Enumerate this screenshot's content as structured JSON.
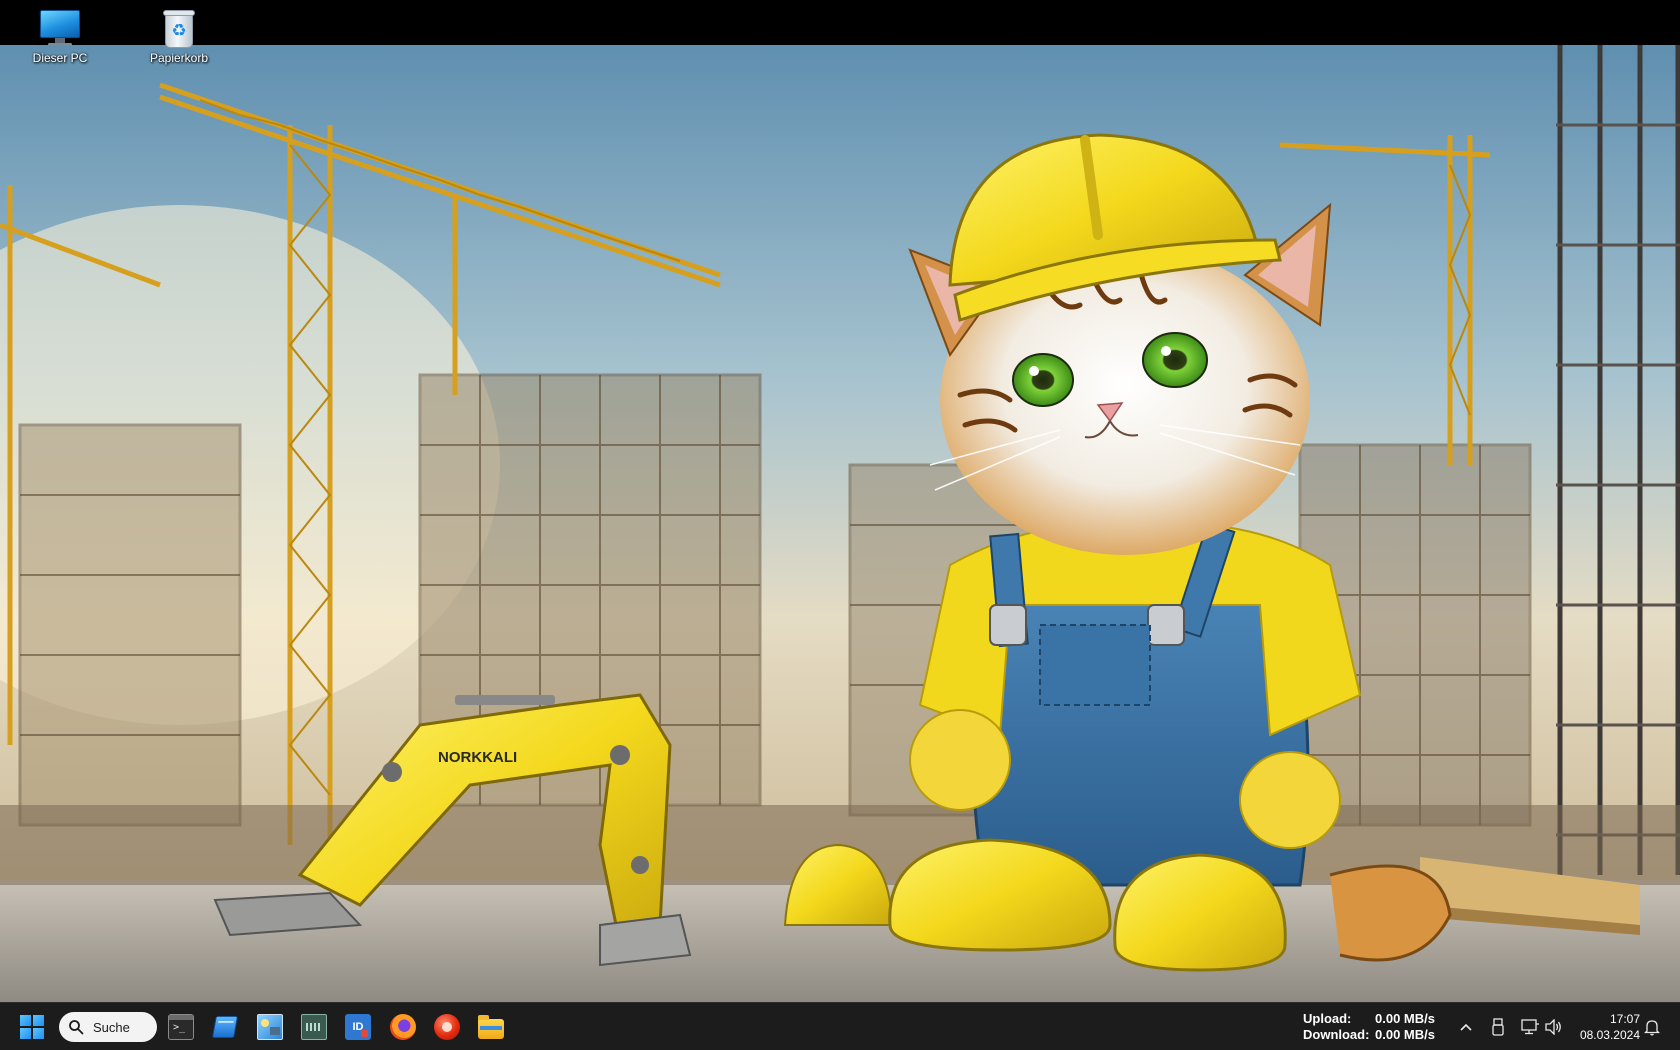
{
  "desktop": {
    "icons": [
      {
        "label": "Dieser PC",
        "icon": "computer-icon"
      },
      {
        "label": "Papierkorb",
        "icon": "recycle-bin-icon"
      }
    ],
    "wallpaper_text": "NORKKALI"
  },
  "taskbar": {
    "start": {
      "icon": "windows-start-icon"
    },
    "search": {
      "label": "Suche"
    },
    "apps": [
      {
        "id": "terminal",
        "icon": "terminal-icon",
        "glyph": ">_"
      },
      {
        "id": "window-app",
        "icon": "window-icon"
      },
      {
        "id": "display-settings",
        "icon": "display-icon"
      },
      {
        "id": "hardware-monitor",
        "icon": "chip-icon"
      },
      {
        "id": "id-app",
        "icon": "id-icon",
        "glyph": "ID"
      },
      {
        "id": "firefox",
        "icon": "firefox-icon"
      },
      {
        "id": "recorder",
        "icon": "record-icon"
      },
      {
        "id": "file-explorer",
        "icon": "folder-icon"
      }
    ],
    "network": {
      "upload_label": "Upload:",
      "upload_value": "0.00 MB/s",
      "download_label": "Download:",
      "download_value": "0.00 MB/s"
    },
    "tray": [
      {
        "icon": "chevron-up-icon"
      },
      {
        "icon": "usb-icon"
      },
      {
        "icon": "network-icon"
      },
      {
        "icon": "speaker-icon"
      },
      {
        "icon": "bell-icon"
      }
    ],
    "clock": {
      "time": "17:07",
      "date": "08.03.2024"
    }
  },
  "colors": {
    "taskbar_bg": "#1c1c1c",
    "accent": "#1f8ef1",
    "helmet_yellow": "#f5e02a"
  }
}
